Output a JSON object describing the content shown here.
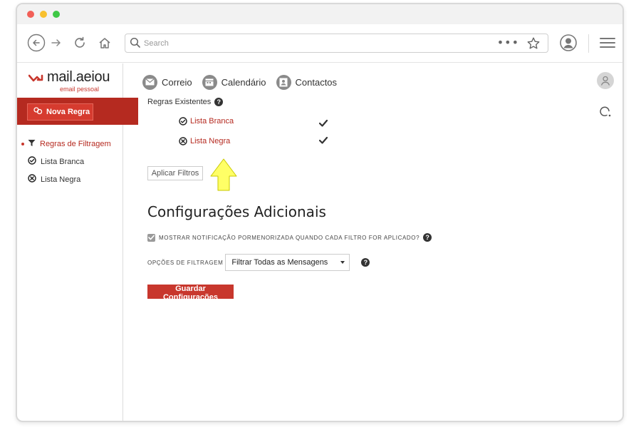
{
  "browser": {
    "search_placeholder": "Search",
    "more_label": "•••"
  },
  "logo": {
    "name": "mail.aeiou",
    "tagline": "email pessoal"
  },
  "sidebar": {
    "new_rule_label": "Nova Regra",
    "items": [
      {
        "label": "Regras de Filtragem",
        "icon": "filter-icon",
        "active": true
      },
      {
        "label": "Lista Branca",
        "icon": "check-circle-icon",
        "active": false
      },
      {
        "label": "Lista Negra",
        "icon": "x-circle-icon",
        "active": false
      }
    ]
  },
  "topnav": {
    "items": [
      {
        "label": "Correio",
        "icon": "mail-icon"
      },
      {
        "label": "Calendário",
        "icon": "calendar-icon"
      },
      {
        "label": "Contactos",
        "icon": "contacts-icon"
      }
    ]
  },
  "rules": {
    "section_label": "Regras Existentes",
    "items": [
      {
        "label": "Lista Branca",
        "icon": "check-circle-icon",
        "enabled": true
      },
      {
        "label": "Lista Negra",
        "icon": "x-circle-icon",
        "enabled": true
      }
    ],
    "apply_label": "Aplicar Filtros"
  },
  "config": {
    "title": "Configurações Adicionais",
    "notify_label": "MOSTRAR NOTIFICAÇÃO PORMENORIZADA QUANDO CADA FILTRO FOR APLICADO?",
    "notify_checked": true,
    "filter_options_label": "OPÇÕES DE FILTRAGEM",
    "filter_selected": "Filtrar Todas as Mensagens",
    "save_label": "Guardar Configurações"
  },
  "colors": {
    "brand": "#c8372d",
    "brand_dark": "#b52a20",
    "arrow": "#ffff66"
  }
}
